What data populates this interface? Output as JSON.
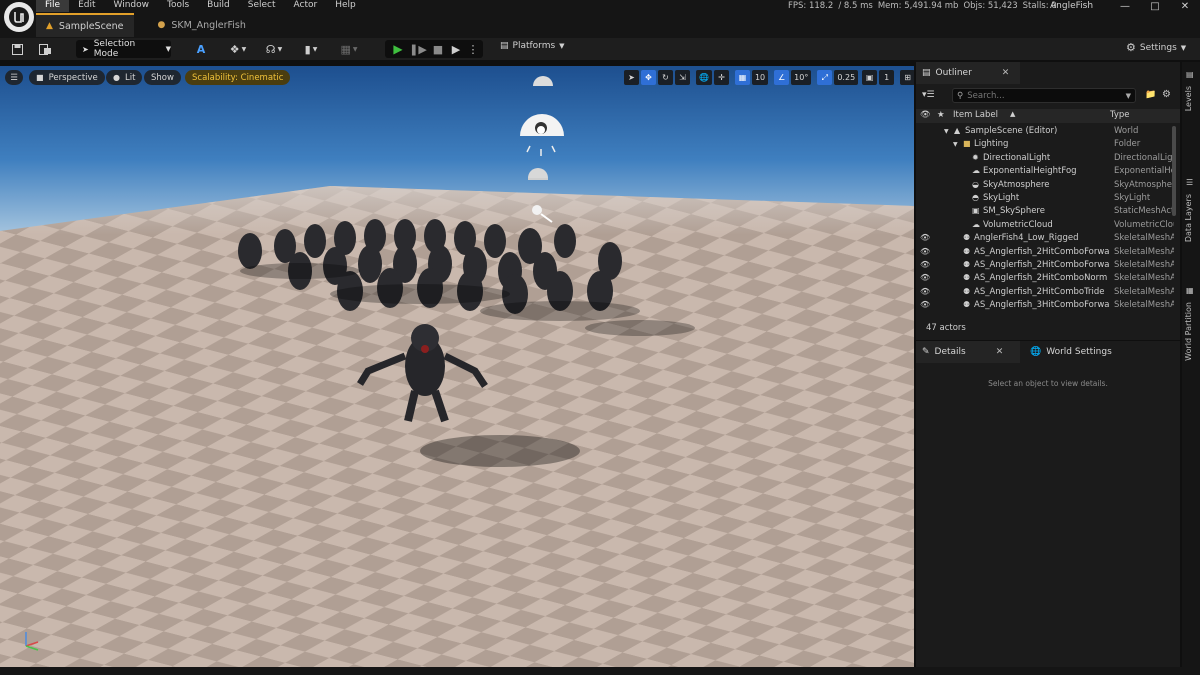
{
  "menu": [
    "File",
    "Edit",
    "Window",
    "Tools",
    "Build",
    "Select",
    "Actor",
    "Help"
  ],
  "stats": {
    "fps": "FPS: 118.2",
    "ms": "/ 8.5 ms",
    "mem": "Mem: 5,491.94 mb",
    "objs": "Objs: 51,423",
    "stalls": "Stalls: 0"
  },
  "project_name": "AngleFish",
  "tabs": [
    {
      "label": "SampleScene",
      "active": true
    },
    {
      "label": "SKM_AnglerFish",
      "active": false
    }
  ],
  "toolbar": {
    "selection_mode": "Selection Mode",
    "platforms": "Platforms",
    "settings": "Settings"
  },
  "viewport": {
    "perspective": "Perspective",
    "lit": "Lit",
    "show": "Show",
    "scalability": "Scalability: Cinematic",
    "grid_snap": "10",
    "rotation_snap": "10°",
    "scale_snap": "0.25",
    "camera_speed": "1"
  },
  "outliner": {
    "tab_label": "Outliner",
    "search_placeholder": "Search...",
    "col_label": "Item Label",
    "col_type": "Type",
    "rows": [
      {
        "name": "SampleScene (Editor)",
        "type": "World",
        "indent": 1,
        "icon": "world-icon"
      },
      {
        "name": "Lighting",
        "type": "Folder",
        "indent": 2,
        "icon": "folder-icon"
      },
      {
        "name": "DirectionalLight",
        "type": "DirectionalLigh",
        "indent": 3,
        "icon": "light-icon"
      },
      {
        "name": "ExponentialHeightFog",
        "type": "ExponentialHei",
        "indent": 3,
        "icon": "fog-icon"
      },
      {
        "name": "SkyAtmosphere",
        "type": "SkyAtmospher",
        "indent": 3,
        "icon": "atmosphere-icon"
      },
      {
        "name": "SkyLight",
        "type": "SkyLight",
        "indent": 3,
        "icon": "skylight-icon"
      },
      {
        "name": "SM_SkySphere",
        "type": "StaticMeshActo",
        "indent": 3,
        "icon": "mesh-icon"
      },
      {
        "name": "VolumetricCloud",
        "type": "VolumetricClou",
        "indent": 3,
        "icon": "cloud-icon"
      },
      {
        "name": "AnglerFish4_Low_Rigged",
        "type": "SkeletalMeshA",
        "indent": 2,
        "icon": "skeletal-icon"
      },
      {
        "name": "AS_Anglerfish_2HitComboForwa",
        "type": "SkeletalMeshA",
        "indent": 2,
        "icon": "skeletal-icon"
      },
      {
        "name": "AS_Anglerfish_2HitComboForwa",
        "type": "SkeletalMeshA",
        "indent": 2,
        "icon": "skeletal-icon"
      },
      {
        "name": "AS_Anglerfish_2HitComboNorm",
        "type": "SkeletalMeshA",
        "indent": 2,
        "icon": "skeletal-icon"
      },
      {
        "name": "AS_Anglerfish_2HitComboTride",
        "type": "SkeletalMeshA",
        "indent": 2,
        "icon": "skeletal-icon"
      },
      {
        "name": "AS_Anglerfish_3HitComboForwa",
        "type": "SkeletalMeshA",
        "indent": 2,
        "icon": "skeletal-icon"
      }
    ],
    "actor_count": "47 actors"
  },
  "details": {
    "tab_label": "Details",
    "world_settings_label": "World Settings",
    "empty_message": "Select an object to view details."
  },
  "side_tabs": [
    "Levels",
    "Data Layers",
    "World Partition"
  ],
  "colors": {
    "accent": "#e2a02a",
    "play": "#3fbf3f",
    "select_blue": "#2f6fd6"
  }
}
